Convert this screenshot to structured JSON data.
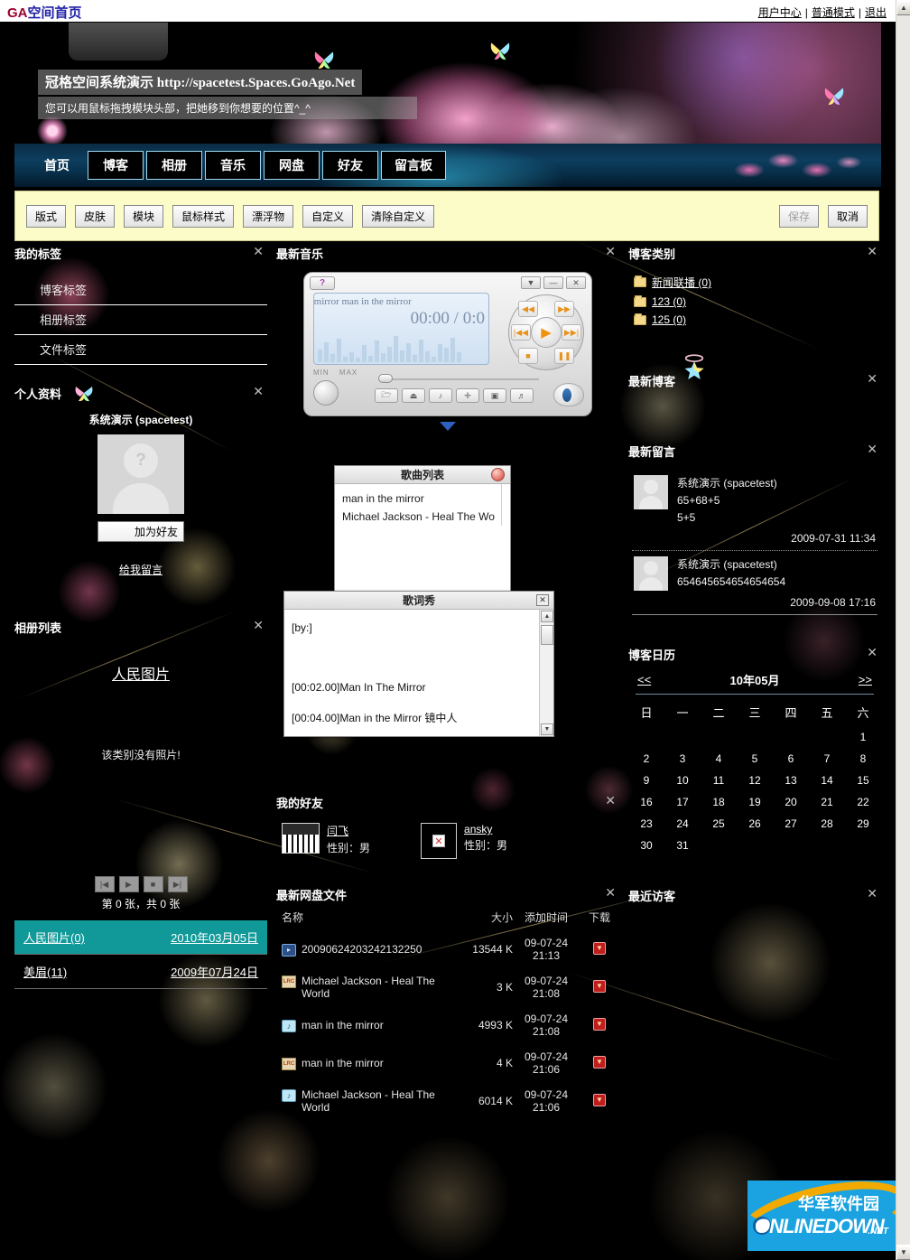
{
  "topbar": {
    "logo_ga": "GA",
    "logo_cn": "空间首页",
    "links": [
      "用户中心",
      "普通模式",
      "退出"
    ],
    "separator": "|"
  },
  "banner": {
    "headline": "冠格空间系统演示 http://spacetest.Spaces.GoAgo.Net",
    "subline": "您可以用鼠标拖拽模块头部，把她移到你想要的位置^_^"
  },
  "nav": {
    "items": [
      "首页",
      "博客",
      "相册",
      "音乐",
      "网盘",
      "好友",
      "留言板"
    ]
  },
  "toolbar": {
    "buttons": [
      "版式",
      "皮肤",
      "模块",
      "鼠标样式",
      "漂浮物",
      "自定义",
      "清除自定义"
    ],
    "save_label": "保存",
    "cancel_label": "取消"
  },
  "close_glyph": "✕",
  "left": {
    "tags_module": {
      "title": "我的标签",
      "items": [
        "博客标签",
        "相册标签",
        "文件标签"
      ]
    },
    "profile_module": {
      "title": "个人资料",
      "user_name": "系统演示 (spacetest)",
      "add_friend_label": "加为好友",
      "leave_message_label": "给我留言"
    },
    "album_module": {
      "title": "相册列表",
      "album_link": "人民图片",
      "empty_text": "该类别没有照片!",
      "nav_buttons": [
        "|◀",
        "▶",
        "■",
        "▶|"
      ],
      "counter": "第 0 张，共 0 张",
      "rows": [
        {
          "name": "人民图片(0)",
          "date": "2010年03月05日",
          "selected": true
        },
        {
          "name": "美眉(11)",
          "date": "2009年07月24日",
          "selected": false
        }
      ]
    }
  },
  "middle": {
    "music_module": {
      "title": "最新音乐",
      "help_label": "?",
      "win_buttons": [
        "▼",
        "—",
        "✕"
      ],
      "marquee": "e mirror   man in the mirror",
      "time": "00:00 / 0:0",
      "min_label": "MIN",
      "max_label": "MAX",
      "transport": {
        "rew": "◀◀",
        "ff": "▶▶",
        "prev": "|◀◀",
        "next": "▶▶|",
        "stop": "■",
        "pause": "❚❚",
        "play": "▶"
      },
      "fn_buttons": [
        "🗁",
        "⏏",
        "♪",
        "✛",
        "▣",
        "♬"
      ],
      "visualizer": [
        14,
        22,
        9,
        26,
        6,
        11,
        5,
        19,
        7,
        24,
        10,
        17,
        29,
        13,
        21,
        8,
        25,
        12,
        6,
        20,
        16,
        27,
        11
      ]
    },
    "songlist_window": {
      "title": "歌曲列表",
      "songs": [
        "man in the mirror",
        "Michael Jackson - Heal The Wo"
      ]
    },
    "lyrics_window": {
      "title": "歌词秀",
      "lines": [
        "[by:]",
        "",
        "[00:02.00]Man In The Mirror",
        "[00:04.00]Man in the Mirror 镜中人"
      ]
    },
    "friends_module": {
      "title": "我的好友",
      "friends": [
        {
          "name": "闫飞",
          "gender": "性别：男",
          "icon": "piano-thumb"
        },
        {
          "name": "ansky",
          "gender": "性别：男",
          "icon": "broken-image-icon"
        }
      ]
    },
    "netdisk_module": {
      "title": "最新网盘文件",
      "columns": [
        "名称",
        "大小",
        "添加时间",
        "下载"
      ],
      "rows": [
        {
          "icon": "media-file-icon",
          "name": "20090624203242132250",
          "size": "13544 K",
          "time": "09-07-24 21:13"
        },
        {
          "icon": "lrc-file-icon",
          "name": "Michael Jackson - Heal The World",
          "size": "3 K",
          "time": "09-07-24 21:08"
        },
        {
          "icon": "audio-file-icon",
          "name": "man in the mirror",
          "size": "4993 K",
          "time": "09-07-24 21:08"
        },
        {
          "icon": "lrc-file-icon",
          "name": "man in the mirror",
          "size": "4 K",
          "time": "09-07-24 21:06"
        },
        {
          "icon": "audio-file-icon",
          "name": "Michael Jackson - Heal The World",
          "size": "6014 K",
          "time": "09-07-24 21:06"
        }
      ]
    }
  },
  "right": {
    "category_module": {
      "title": "博客类别",
      "items": [
        "新闻联播 (0)",
        "123 (0)",
        "125 (0)"
      ]
    },
    "latest_blog_module": {
      "title": "最新博客"
    },
    "latest_message_module": {
      "title": "最新留言",
      "messages": [
        {
          "user": "系统演示 (spacetest)",
          "lines": [
            "65+68+5",
            "5+5"
          ],
          "date": "2009-07-31 11:34"
        },
        {
          "user": "系统演示 (spacetest)",
          "lines": [
            "654645654654654654"
          ],
          "date": "2009-09-08 17:16"
        }
      ]
    },
    "calendar_module": {
      "title": "博客日历",
      "prev_label": "<<",
      "next_label": ">>",
      "month_label": "10年05月",
      "weekdays": [
        "日",
        "一",
        "二",
        "三",
        "四",
        "五",
        "六"
      ],
      "weeks": [
        [
          "",
          "",
          "",
          "",
          "",
          "",
          "1"
        ],
        [
          "2",
          "3",
          "4",
          "5",
          "6",
          "7",
          "8"
        ],
        [
          "9",
          "10",
          "11",
          "12",
          "13",
          "14",
          "15"
        ],
        [
          "16",
          "17",
          "18",
          "19",
          "20",
          "21",
          "22"
        ],
        [
          "23",
          "24",
          "25",
          "26",
          "27",
          "28",
          "29"
        ],
        [
          "30",
          "31",
          "",
          "",
          "",
          "",
          ""
        ]
      ]
    },
    "visitors_module": {
      "title": "最近访客"
    }
  },
  "footer_logo": {
    "cn": "华军软件园",
    "en": "ONLINEDOWN",
    "net": ".NET"
  },
  "scrollbar": {
    "up": "▲",
    "down": "▼"
  }
}
